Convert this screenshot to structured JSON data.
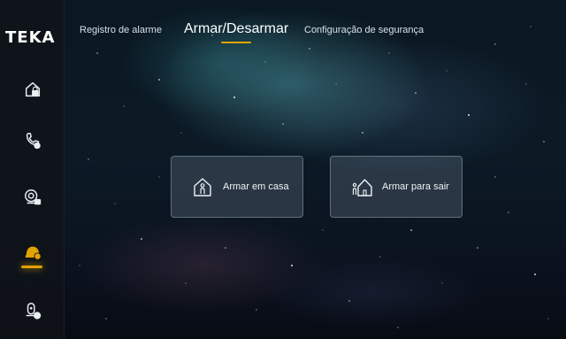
{
  "brand": {
    "logo_text": "TEKA"
  },
  "sidebar": {
    "items": [
      {
        "icon": "house-lock-icon",
        "active": false
      },
      {
        "icon": "phone-call-icon",
        "active": false
      },
      {
        "icon": "camera-icon",
        "active": false
      },
      {
        "icon": "security-shield-icon",
        "active": true
      },
      {
        "icon": "sos-icon",
        "active": false
      }
    ],
    "active_color": "#e2a400"
  },
  "tabs": [
    {
      "label": "Registro de alarme",
      "active": false
    },
    {
      "label": "Armar/Desarmar",
      "active": true
    },
    {
      "label": "Configuração de segurança",
      "active": false
    }
  ],
  "actions": {
    "arm_home": {
      "label": "Armar em casa",
      "icon": "person-in-house-icon"
    },
    "arm_away": {
      "label": "Armar para sair",
      "icon": "person-leaving-house-icon"
    }
  },
  "theme": {
    "accent": "#e2a400"
  }
}
